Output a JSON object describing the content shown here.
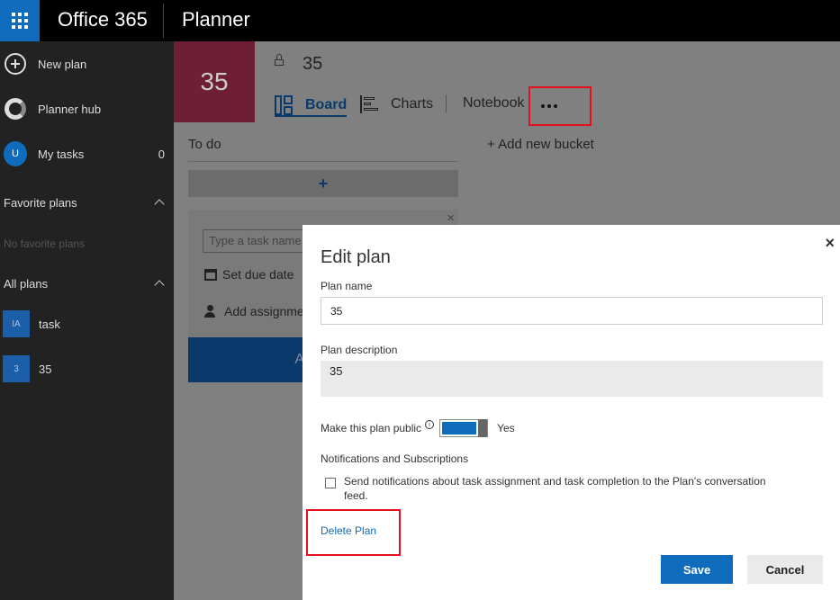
{
  "header": {
    "suite": "Office 365",
    "app": "Planner"
  },
  "leftnav": {
    "new_plan": "New plan",
    "hub": "Planner hub",
    "my_tasks": {
      "label": "My tasks",
      "avatar": "U",
      "count": "0"
    },
    "favorites": {
      "title": "Favorite plans",
      "empty": "No favorite plans"
    },
    "all_plans": {
      "title": "All plans",
      "items": [
        {
          "tile": "IA",
          "label": "task"
        },
        {
          "tile": "3",
          "label": "35"
        }
      ]
    }
  },
  "plan": {
    "badge": "35",
    "name": "35",
    "tabs": {
      "board": "Board",
      "charts": "Charts",
      "notebook": "Notebook"
    }
  },
  "board": {
    "bucket": "To do",
    "add_task": "+",
    "add_bucket": "+ Add new bucket",
    "task_card": {
      "placeholder": "Type a task name",
      "set_due": "Set due date",
      "assign": "Add assignme",
      "add_button": "A"
    }
  },
  "dialog": {
    "title": "Edit plan",
    "close": "×",
    "name_label": "Plan name",
    "name_value": "35",
    "desc_label": "Plan description",
    "desc_value": "35",
    "public_label": "Make this plan public",
    "info": "i",
    "public_state": "Yes",
    "notif_label": "Notifications and Subscriptions",
    "notif_text": "Send notifications about task assignment and task completion to the Plan's conversation feed.",
    "delete": "Delete Plan",
    "save": "Save",
    "cancel": "Cancel"
  },
  "colors": {
    "accent": "#0f6cbd",
    "highlight": "#e3111e",
    "plan_badge": "#6e1f35"
  }
}
